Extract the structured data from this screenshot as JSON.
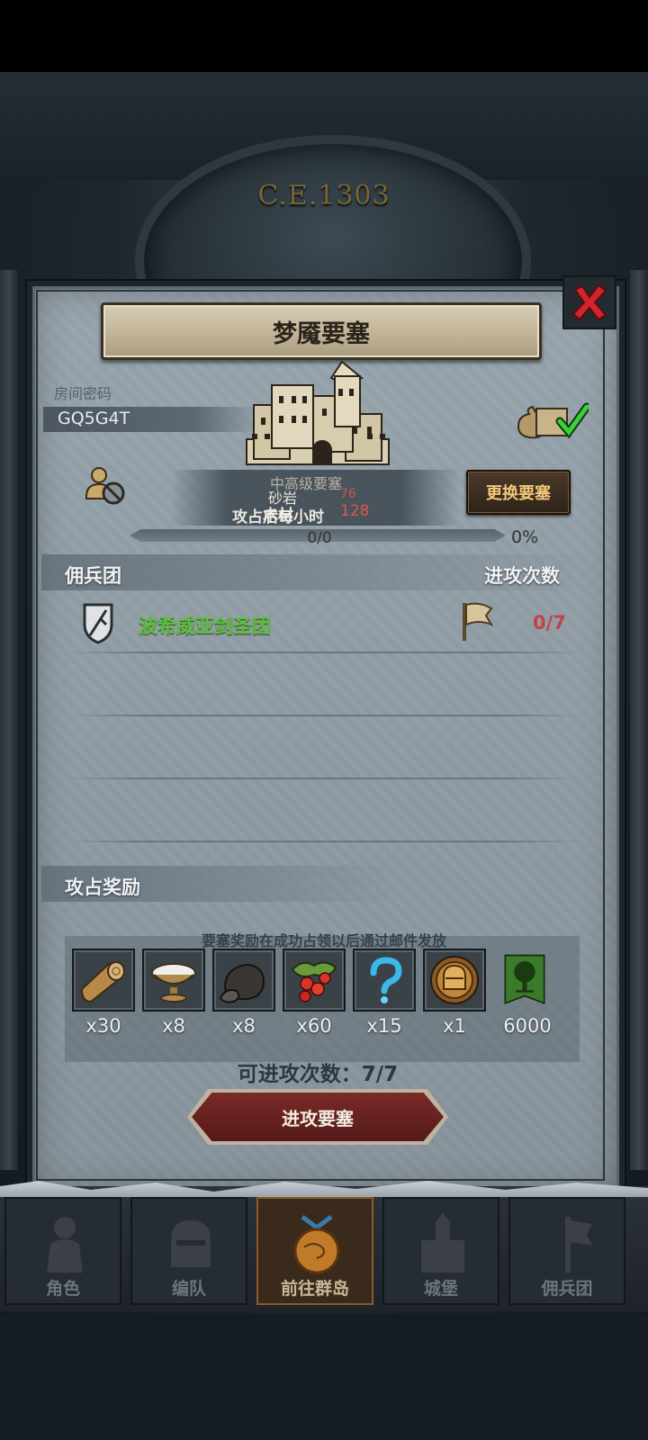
{
  "background": {
    "calendar_date": "C.E.1303"
  },
  "dialog": {
    "title": "梦魇要塞",
    "room_code_label": "房间密码",
    "room_code": "GQ5G4T",
    "fortress_level": "中高级要塞",
    "stone_label": "砂岩",
    "stone_value": "76",
    "wood_label": "木材",
    "wood_value": "128",
    "occupy_hint": "攻占后每小时",
    "change_button": "更换要塞",
    "progress": {
      "label": "0/0",
      "percent_text": "0%",
      "fraction": 0.0
    },
    "mercenary_header": "佣兵团",
    "attack_count_header": "进攻次数",
    "mercenary_rows": [
      {
        "name": "波希威亚剑圣团",
        "attacks": "0/7"
      }
    ],
    "reward_header": "攻占奖励",
    "reward_subtitle": "要塞奖励在成功占领以后通过邮件发放",
    "rewards": [
      {
        "icon": "wood-log-icon",
        "count": "x30"
      },
      {
        "icon": "salt-bowl-icon",
        "count": "x8"
      },
      {
        "icon": "truffle-icon",
        "count": "x8"
      },
      {
        "icon": "berries-icon",
        "count": "x60"
      },
      {
        "icon": "mystery-question-icon",
        "count": "x15"
      },
      {
        "icon": "knight-helmet-medal-icon",
        "count": "x1"
      },
      {
        "icon": "tree-banner-icon",
        "count": "6000"
      }
    ],
    "remaining_attacks": "可进攻次数：7/7",
    "attack_button": "进攻要塞"
  },
  "nav": {
    "items": [
      {
        "label": "角色",
        "active": false
      },
      {
        "label": "编队",
        "active": false
      },
      {
        "label": "前往群岛",
        "active": true
      },
      {
        "label": "城堡",
        "active": false
      },
      {
        "label": "佣兵团",
        "active": false
      }
    ]
  },
  "colors": {
    "mercenary_name": "#5fbf40",
    "attack_count": "#c0454a",
    "button_gold_text": "#f2c879",
    "attack_button": "#6a2422"
  }
}
